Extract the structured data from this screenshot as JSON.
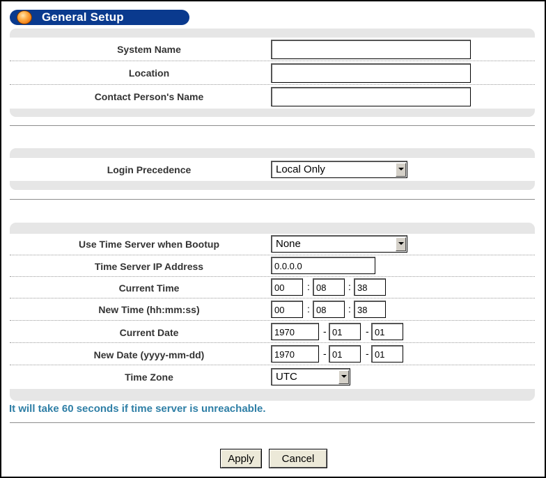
{
  "title": "General Setup",
  "section1": {
    "rows": [
      {
        "label": "System Name",
        "value": ""
      },
      {
        "label": "Location",
        "value": ""
      },
      {
        "label": "Contact Person's Name",
        "value": ""
      }
    ]
  },
  "section2": {
    "login_precedence_label": "Login Precedence",
    "login_precedence_value": "Local Only"
  },
  "section3": {
    "time_server_label": "Use Time Server when Bootup",
    "time_server_value": "None",
    "time_server_ip_label": "Time Server IP Address",
    "time_server_ip_value": "0.0.0.0",
    "current_time_label": "Current Time",
    "current_time": {
      "hh": "00",
      "mm": "08",
      "ss": "38"
    },
    "new_time_label": "New Time (hh:mm:ss)",
    "new_time": {
      "hh": "00",
      "mm": "08",
      "ss": "38"
    },
    "current_date_label": "Current Date",
    "current_date": {
      "yyyy": "1970",
      "mm": "01",
      "dd": "01"
    },
    "new_date_label": "New Date (yyyy-mm-dd)",
    "new_date": {
      "yyyy": "1970",
      "mm": "01",
      "dd": "01"
    },
    "time_zone_label": "Time Zone",
    "time_zone_value": "UTC",
    "time_sep": ":",
    "date_sep": "-"
  },
  "note": "It will take 60 seconds if time server is unreachable.",
  "buttons": {
    "apply": "Apply",
    "cancel": "Cancel"
  },
  "colors": {
    "title_pill": "#0a3a8e",
    "note_text": "#2f7fa6",
    "panel": "#e6e6e6"
  }
}
